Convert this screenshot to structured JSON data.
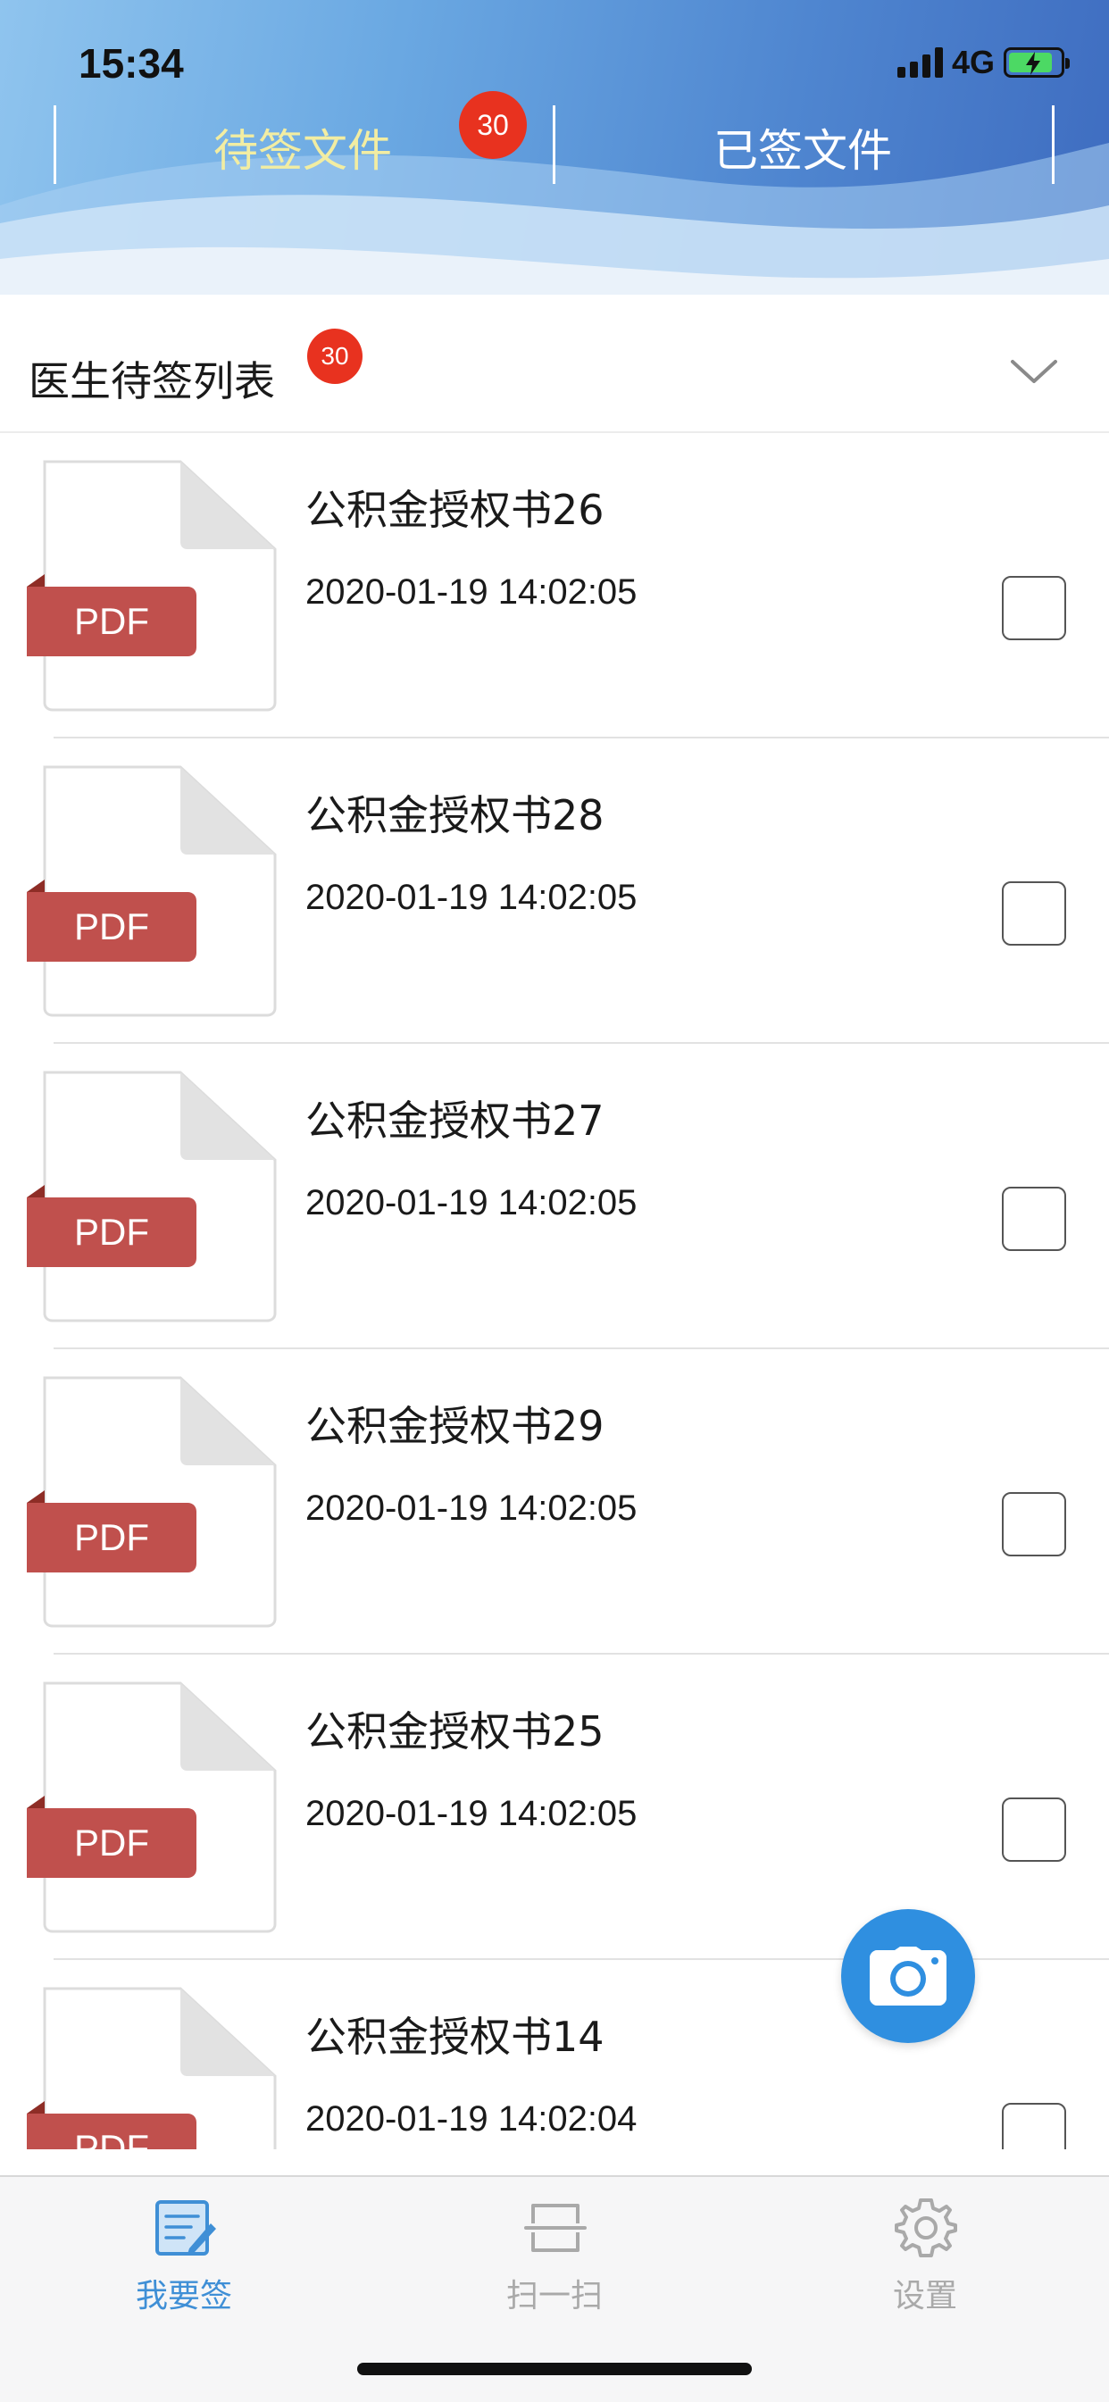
{
  "status_bar": {
    "time": "15:34",
    "network": "4G"
  },
  "tabs": [
    {
      "label": "待签文件",
      "badge": "30",
      "active": true
    },
    {
      "label": "已签文件",
      "active": false
    }
  ],
  "section": {
    "title": "医生待签列表",
    "badge": "30"
  },
  "file_icon_label": "PDF",
  "documents": [
    {
      "title": "公积金授权书26",
      "time": "2020-01-19 14:02:05",
      "checked": false
    },
    {
      "title": "公积金授权书28",
      "time": "2020-01-19 14:02:05",
      "checked": false
    },
    {
      "title": "公积金授权书27",
      "time": "2020-01-19 14:02:05",
      "checked": false
    },
    {
      "title": "公积金授权书29",
      "time": "2020-01-19 14:02:05",
      "checked": false
    },
    {
      "title": "公积金授权书25",
      "time": "2020-01-19 14:02:05",
      "checked": false
    },
    {
      "title": "公积金授权书14",
      "time": "2020-01-19 14:02:04",
      "checked": false
    }
  ],
  "bottom_nav": [
    {
      "label": "我要签",
      "icon": "sign-icon",
      "active": true
    },
    {
      "label": "扫一扫",
      "icon": "scan-icon",
      "active": false
    },
    {
      "label": "设置",
      "icon": "gear-icon",
      "active": false
    }
  ],
  "colors": {
    "accent": "#3f8fd6",
    "badge": "#e8321f",
    "pdf_red": "#c0504d",
    "active_tab_text": "#f2eda2"
  }
}
